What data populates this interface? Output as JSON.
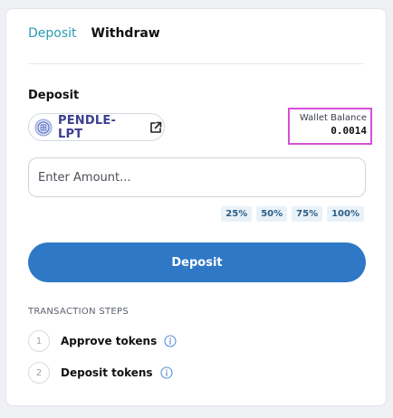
{
  "tabs": [
    {
      "label": "Deposit",
      "active": true
    },
    {
      "label": "Withdraw",
      "active": false
    }
  ],
  "section_title": "Deposit",
  "token": {
    "name": "PENDLE-LPT",
    "logo_icon": "pendle-logo-icon",
    "link_icon": "external-link-icon"
  },
  "wallet": {
    "label": "Wallet Balance",
    "value": "0.0014",
    "highlight_color": "#d64fd6"
  },
  "amount_input": {
    "placeholder": "Enter Amount...",
    "value": ""
  },
  "percent_buttons": [
    "25%",
    "50%",
    "75%",
    "100%"
  ],
  "deposit_button": {
    "label": "Deposit",
    "color": "#2e78c6"
  },
  "transaction_steps": {
    "title": "TRANSACTION STEPS",
    "steps": [
      {
        "number": "1",
        "label": "Approve tokens"
      },
      {
        "number": "2",
        "label": "Deposit tokens"
      }
    ]
  },
  "colors": {
    "accent": "#2a9bb4",
    "info_icon": "#5b8fd6"
  }
}
